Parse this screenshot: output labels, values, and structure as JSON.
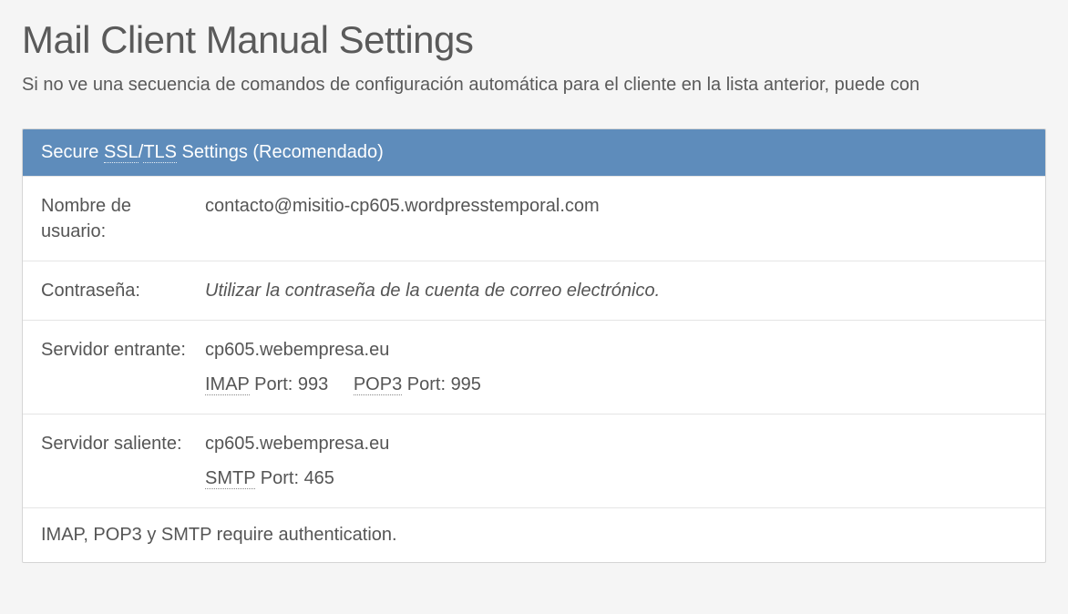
{
  "header": {
    "title": "Mail Client Manual Settings",
    "subtitle": "Si no ve una secuencia de comandos de configuración automática para el cliente en la lista anterior, puede con"
  },
  "panel": {
    "header": {
      "prefix": "Secure ",
      "ssl": "SSL",
      "slash": "/",
      "tls": "TLS",
      "suffix": " Settings (Recomendado)"
    },
    "rows": {
      "username": {
        "label": "Nombre de usuario:",
        "value": "contacto@misitio-cp605.wordpresstemporal.com"
      },
      "password": {
        "label": "Contraseña:",
        "value": "Utilizar la contraseña de la cuenta de correo electrónico."
      },
      "incoming": {
        "label": "Servidor entrante:",
        "host": "cp605.webempresa.eu",
        "imap_abbr": "IMAP",
        "imap_port_label": " Port: ",
        "imap_port": "993",
        "pop3_abbr": "POP3",
        "pop3_port_label": " Port: ",
        "pop3_port": "995"
      },
      "outgoing": {
        "label": "Servidor saliente:",
        "host": "cp605.webempresa.eu",
        "smtp_abbr": "SMTP",
        "smtp_port_label": " Port: ",
        "smtp_port": "465"
      }
    },
    "footer": "IMAP, POP3 y SMTP require authentication."
  }
}
